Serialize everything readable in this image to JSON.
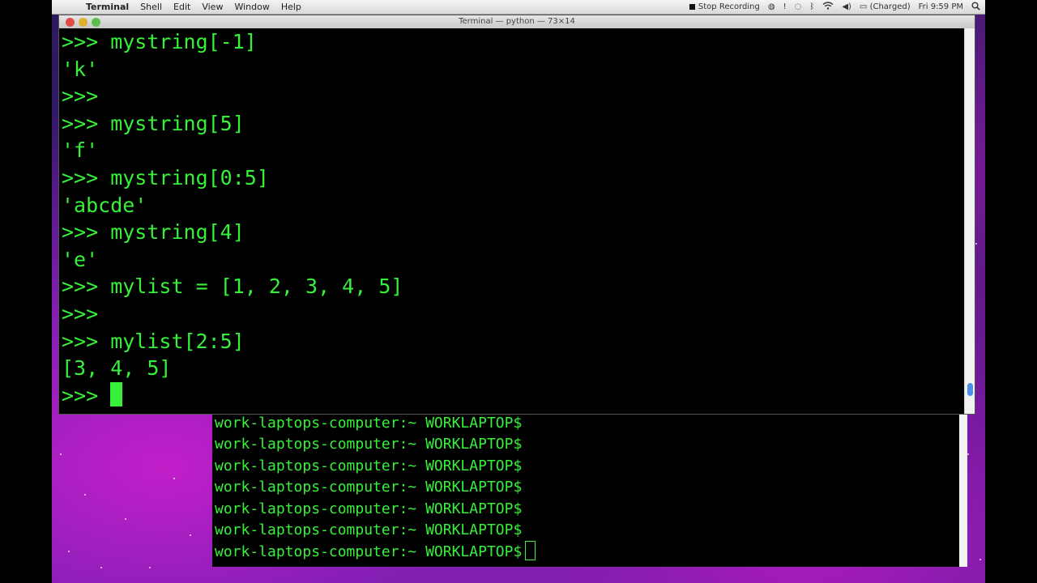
{
  "menubar": {
    "apple_glyph": "",
    "app_name": "Terminal",
    "menus": [
      "Shell",
      "Edit",
      "View",
      "Window",
      "Help"
    ],
    "stop_recording": "Stop Recording",
    "battery": "(Charged)",
    "clock": "Fri 9:59 PM"
  },
  "python_window": {
    "title": "Terminal — python — 73×14",
    "lines": [
      ">>> mystring[-1]",
      "'k'",
      ">>>",
      ">>> mystring[5]",
      "'f'",
      ">>> mystring[0:5]",
      "'abcde'",
      ">>> mystring[4]",
      "'e'",
      ">>> mylist = [1, 2, 3, 4, 5]",
      ">>>",
      ">>> mylist[2:5]",
      "[3, 4, 5]"
    ],
    "prompt": ">>> "
  },
  "shell_window": {
    "lines": [
      "work-laptops-computer:~ WORKLAPTOP$",
      "work-laptops-computer:~ WORKLAPTOP$",
      "work-laptops-computer:~ WORKLAPTOP$",
      "work-laptops-computer:~ WORKLAPTOP$",
      "work-laptops-computer:~ WORKLAPTOP$",
      "work-laptops-computer:~ WORKLAPTOP$"
    ],
    "prompt": "work-laptops-computer:~ WORKLAPTOP$"
  },
  "colors": {
    "terminal_text": "#37f03a",
    "terminal_bg": "#000000"
  }
}
